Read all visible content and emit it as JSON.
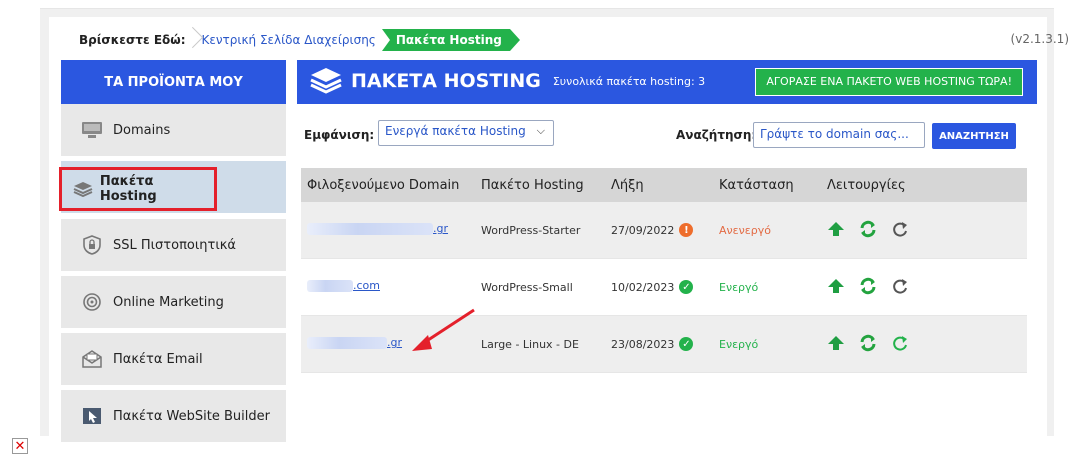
{
  "breadcrumb": {
    "label": "Βρίσκεστε Εδώ:",
    "home": "Κεντρική Σελίδα Διαχείρισης",
    "current": "Πακέτα Hosting"
  },
  "version": "(v2.1.3.1)",
  "sidebar": {
    "header": "ΤΑ ΠΡΟΪΟΝΤΑ ΜΟΥ",
    "items": [
      {
        "label": "Domains",
        "icon": "monitor-icon"
      },
      {
        "label": "Πακέτα Hosting",
        "icon": "layers-icon"
      },
      {
        "label": "SSL Πιστοποιητικά",
        "icon": "lock-shield-icon"
      },
      {
        "label": "Online Marketing",
        "icon": "target-icon"
      },
      {
        "label": "Πακέτα Email",
        "icon": "envelope-icon"
      },
      {
        "label": "Πακέτα WebSite Builder",
        "icon": "cursor-icon"
      }
    ]
  },
  "main": {
    "title": "ΠΑΚΕΤΑ HOSTING",
    "subtitle": "Συνολικά πακέτα hosting: 3",
    "buy_button": "ΑΓΟΡΑΣΕ ΕΝΑ ΠΑΚΕΤΟ WEB HOSTING ΤΩΡΑ!"
  },
  "filters": {
    "show_label": "Εμφάνιση:",
    "show_value": "Ενεργά πακέτα Hosting",
    "search_label": "Αναζήτηση:",
    "search_placeholder": "Γράψτε το domain σας...",
    "search_button": "ΑΝΑΖΗΤΗΣΗ"
  },
  "table": {
    "headers": [
      "Φιλοξενούμενο Domain",
      "Πακέτο Hosting",
      "Λήξη",
      "Κατάσταση",
      "Λειτουργίες"
    ],
    "rows": [
      {
        "domain_suffix": ".gr",
        "package": "WordPress-Starter",
        "expiry": "27/09/2022",
        "status": "Ανενεργό"
      },
      {
        "domain_suffix": ".com",
        "package": "WordPress-Small",
        "expiry": "10/02/2023",
        "status": "Ενεργό"
      },
      {
        "domain_suffix": ".gr",
        "package": "Large - Linux - DE",
        "expiry": "23/08/2023",
        "status": "Ενεργό"
      }
    ]
  },
  "colors": {
    "brand_blue": "#2b57e0",
    "green": "#23b24b",
    "highlight_red": "#e4202b",
    "inactive_orange": "#e36a43"
  }
}
